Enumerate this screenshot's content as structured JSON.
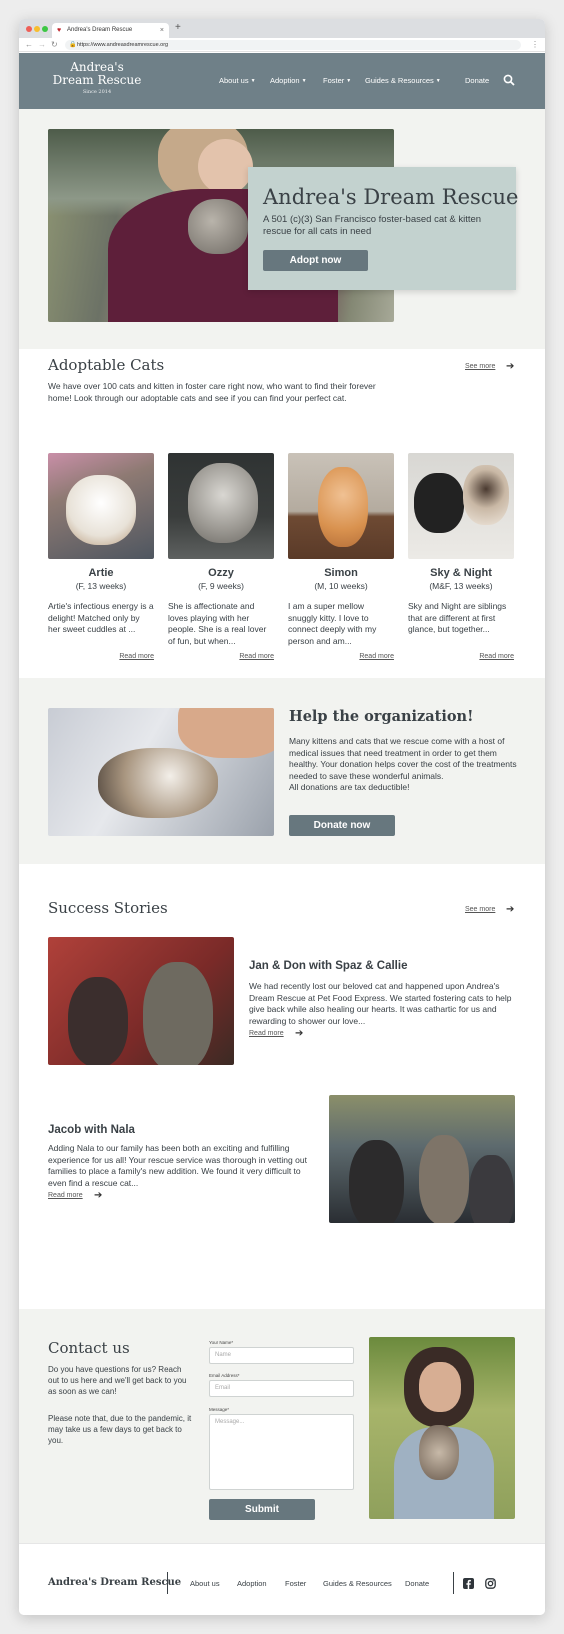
{
  "browser": {
    "tab_title": "Andrea's Dream Rescue",
    "new_tab": "+",
    "url": "https://www.andreasdreamrescue.org"
  },
  "header": {
    "logo_line1": "Andrea's",
    "logo_line2": "Dream Rescue",
    "logo_since": "Since 2014",
    "nav": [
      {
        "label": "About us",
        "dropdown": true
      },
      {
        "label": "Adoption",
        "dropdown": true
      },
      {
        "label": "Foster",
        "dropdown": true
      },
      {
        "label": "Guides & Resources",
        "dropdown": true
      },
      {
        "label": "Donate",
        "dropdown": false
      }
    ]
  },
  "hero": {
    "title": "Andrea's Dream Rescue",
    "subtitle": "A 501 (c)(3) San Francisco foster-based cat & kitten rescue for all cats in need",
    "button": "Adopt now"
  },
  "adoptable": {
    "title": "Adoptable Cats",
    "see_more": "See more",
    "intro": "We have over 100 cats and kitten in foster care right now, who want to find their forever home! Look through our adoptable cats and see if you can find your perfect cat.",
    "cats": [
      {
        "name": "Artie",
        "age": "(F, 13 weeks)",
        "desc": "Artie's infectious energy is a delight! Matched only by her sweet cuddles at ...",
        "read_more": "Read more"
      },
      {
        "name": "Ozzy",
        "age": "(F, 9 weeks)",
        "desc": "She is affectionate and loves playing with her people. She is a real lover of fun, but when...",
        "read_more": "Read more"
      },
      {
        "name": "Simon",
        "age": "(M, 10 weeks)",
        "desc": "I am a super mellow snuggly kitty. I love to connect deeply with my person and am...",
        "read_more": "Read more"
      },
      {
        "name": "Sky & Night",
        "age": "(M&F, 13 weeks)",
        "desc": "Sky and Night are siblings that are different at first glance, but together...",
        "read_more": "Read more"
      }
    ]
  },
  "help": {
    "title": "Help the organization!",
    "text": "Many kittens and cats that we rescue come with a host of medical issues that need treatment in order to get them healthy. Your donation helps cover the cost of the treatments needed to save these wonderful animals.",
    "note": "All donations are tax deductible!",
    "button": "Donate now"
  },
  "stories": {
    "title": "Success Stories",
    "see_more": "See more",
    "items": [
      {
        "title": "Jan & Don with Spaz & Callie",
        "text": "We had recently lost our beloved cat and happened upon Andrea's Dream Rescue at Pet Food Express. We started fostering cats to help give back while also healing our hearts. It was cathartic for us and rewarding to shower our love...",
        "read_more": "Read more"
      },
      {
        "title": "Jacob with Nala",
        "text": "Adding Nala to our family has been both an exciting and fulfilling experience for us all! Your rescue service was thorough in vetting out families to place a family's new addition. We found it very difficult to even find a rescue cat...",
        "read_more": "Read more"
      }
    ]
  },
  "contact": {
    "title": "Contact us",
    "p1": "Do you have questions for us? Reach out to us here and we'll get back to you as soon as we can!",
    "p2": "Please note that, due to the pandemic, it may take us a few days to get back to you.",
    "name_label": "Your Name*",
    "name_placeholder": "Name",
    "email_label": "Email Address*",
    "email_placeholder": "Email",
    "message_label": "Message*",
    "message_placeholder": "Message...",
    "submit": "Submit"
  },
  "footer": {
    "brand": "Andrea's Dream Rescue",
    "links": [
      "About us",
      "Adoption",
      "Foster",
      "Guides & Resources",
      "Donate"
    ],
    "icons": [
      "facebook-icon",
      "instagram-icon"
    ]
  },
  "colors": {
    "header_bg": "#6f8088",
    "hero_box": "#c3d2cf",
    "button": "#67777e",
    "section_bg": "#f2f3f0"
  }
}
